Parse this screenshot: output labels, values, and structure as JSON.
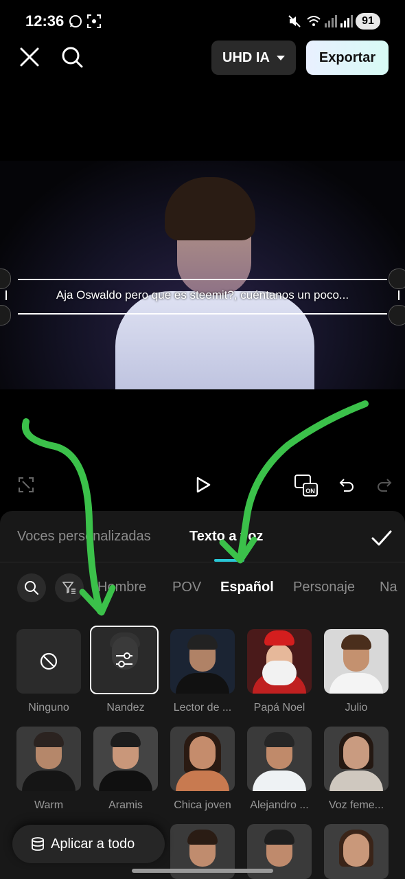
{
  "status_bar": {
    "time": "12:36",
    "battery": "91"
  },
  "toolbar": {
    "quality_label": "UHD IA",
    "export_label": "Exportar"
  },
  "video": {
    "subtitle": "Aja Oswaldo pero que es steemit?, cuéntanos un poco..."
  },
  "panel": {
    "tabs": [
      {
        "label": "Voces personalizadas",
        "active": false
      },
      {
        "label": "Texto a voz",
        "active": true
      }
    ],
    "filters": [
      {
        "label": "Hombre",
        "active": false
      },
      {
        "label": "POV",
        "active": false
      },
      {
        "label": "Español",
        "active": true
      },
      {
        "label": "Personaje",
        "active": false
      },
      {
        "label": "Na",
        "active": false
      }
    ],
    "voices": [
      {
        "label": "Ninguno",
        "icon": "none-icon"
      },
      {
        "label": "Nandez",
        "icon": "sliders-icon",
        "selected": true
      },
      {
        "label": "Lector de ...",
        "icon": "avatar"
      },
      {
        "label": "Papá Noel",
        "icon": "avatar"
      },
      {
        "label": "Julio",
        "icon": "avatar"
      },
      {
        "label": "Warm",
        "icon": "avatar"
      },
      {
        "label": "Aramis",
        "icon": "avatar"
      },
      {
        "label": "Chica joven",
        "icon": "avatar"
      },
      {
        "label": "Alejandro ...",
        "icon": "avatar"
      },
      {
        "label": "Voz feme...",
        "icon": "avatar"
      }
    ],
    "apply_label": "Aplicar a todo"
  },
  "colors": {
    "accent": "#29c7d6",
    "annotation_arrows": "#3bc14a",
    "panel_bg": "#181818"
  }
}
